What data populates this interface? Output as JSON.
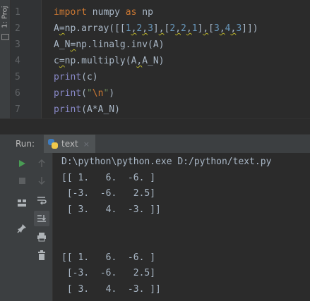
{
  "project_strip": {
    "label": "1: Proj"
  },
  "editor": {
    "line_numbers": [
      "1",
      "2",
      "3",
      "4",
      "5",
      "6",
      "7"
    ],
    "lines": [
      [
        {
          "t": "import",
          "c": "kw"
        },
        {
          "t": " numpy ",
          "c": "dim"
        },
        {
          "t": "as",
          "c": "kw"
        },
        {
          "t": " np",
          "c": "dim"
        }
      ],
      [
        {
          "t": "A",
          "c": "dim"
        },
        {
          "t": "=",
          "c": "squig"
        },
        {
          "t": "np.array([[",
          "c": "dim"
        },
        {
          "t": "1",
          "c": "num"
        },
        {
          "t": ",",
          "c": "squig"
        },
        {
          "t": "2",
          "c": "num"
        },
        {
          "t": ",",
          "c": "squig"
        },
        {
          "t": "3",
          "c": "num"
        },
        {
          "t": "]",
          "c": "dim"
        },
        {
          "t": ",",
          "c": "squig"
        },
        {
          "t": "[",
          "c": "dim"
        },
        {
          "t": "2",
          "c": "num"
        },
        {
          "t": ",",
          "c": "squig"
        },
        {
          "t": "2",
          "c": "num"
        },
        {
          "t": ",",
          "c": "squig"
        },
        {
          "t": "1",
          "c": "num"
        },
        {
          "t": "]",
          "c": "dim"
        },
        {
          "t": ",",
          "c": "squig"
        },
        {
          "t": "[",
          "c": "dim"
        },
        {
          "t": "3",
          "c": "num"
        },
        {
          "t": ",",
          "c": "squig"
        },
        {
          "t": "4",
          "c": "num"
        },
        {
          "t": ",",
          "c": "squig"
        },
        {
          "t": "3",
          "c": "num"
        },
        {
          "t": "]])",
          "c": "dim"
        }
      ],
      [
        {
          "t": "A_N",
          "c": "dim"
        },
        {
          "t": "=",
          "c": "squig"
        },
        {
          "t": "np.linalg.inv(A)",
          "c": "dim"
        }
      ],
      [
        {
          "t": "c",
          "c": "dim"
        },
        {
          "t": "=",
          "c": "squig"
        },
        {
          "t": "np.multiply(A",
          "c": "dim"
        },
        {
          "t": ",",
          "c": "squig"
        },
        {
          "t": "A_N)",
          "c": "dim"
        }
      ],
      [
        {
          "t": "print",
          "c": "builtin"
        },
        {
          "t": "(c)",
          "c": "dim"
        }
      ],
      [
        {
          "t": "print",
          "c": "builtin"
        },
        {
          "t": "(",
          "c": "dim"
        },
        {
          "t": "\"",
          "c": "str"
        },
        {
          "t": "\\n",
          "c": "esc"
        },
        {
          "t": "\"",
          "c": "str"
        },
        {
          "t": ")",
          "c": "dim"
        }
      ],
      [
        {
          "t": "print",
          "c": "builtin"
        },
        {
          "t": "(A*A_N)",
          "c": "dim"
        }
      ]
    ]
  },
  "run_panel": {
    "label": "Run:",
    "tab_label": "text",
    "tab_close": "×",
    "output": [
      "D:\\python\\python.exe D:/python/text.py",
      "[[ 1.   6.  -6. ]",
      " [-3.  -6.   2.5]",
      " [ 3.   4.  -3. ]]",
      "",
      "",
      "[[ 1.   6.  -6. ]",
      " [-3.  -6.   2.5]",
      " [ 3.   4.  -3. ]]"
    ]
  },
  "colors": {
    "keyword": "#cc7832",
    "builtin": "#8888c6",
    "number": "#6897bb",
    "string": "#6a8759",
    "text": "#a9b7c6",
    "warning_underline": "#bbb529",
    "run_green": "#499c54"
  }
}
